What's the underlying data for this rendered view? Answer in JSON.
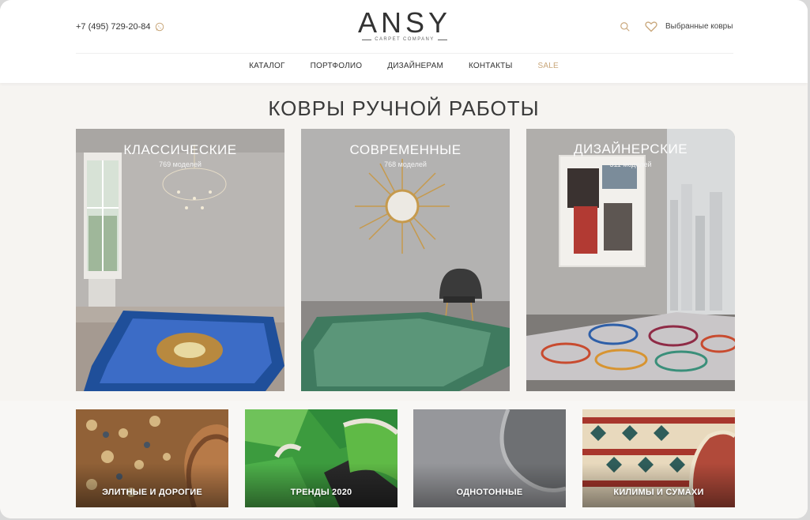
{
  "header": {
    "phone": "+7 (495) 729-20-84",
    "logo": {
      "name": "ANSY",
      "tagline": "CARPET COMPANY"
    },
    "favorites_label": "Выбранные ковры"
  },
  "nav": {
    "items": [
      "КАТАЛОГ",
      "ПОРТФОЛИО",
      "ДИЗАЙНЕРАМ",
      "КОНТАКТЫ",
      "SALE"
    ]
  },
  "section": {
    "title": "КОВРЫ РУЧНОЙ РАБОТЫ"
  },
  "categories": [
    {
      "title": "КЛАССИЧЕСКИЕ",
      "count": "769 моделей"
    },
    {
      "title": "СОВРЕМЕННЫЕ",
      "count": "768 моделей"
    },
    {
      "title": "ДИЗАЙНЕРСКИЕ",
      "count": "311 моделей"
    }
  ],
  "subcategories": [
    {
      "label": "ЭЛИТНЫЕ И ДОРОГИЕ"
    },
    {
      "label": "ТРЕНДЫ 2020"
    },
    {
      "label": "ОДНОТОННЫЕ"
    },
    {
      "label": "КИЛИМЫ И СУМАХИ"
    }
  ],
  "colors": {
    "accent": "#c9a77b",
    "page_bg": "#f6f4f1",
    "text": "#333333"
  },
  "icons": [
    "whatsapp-icon",
    "search-icon",
    "heart-icon"
  ]
}
